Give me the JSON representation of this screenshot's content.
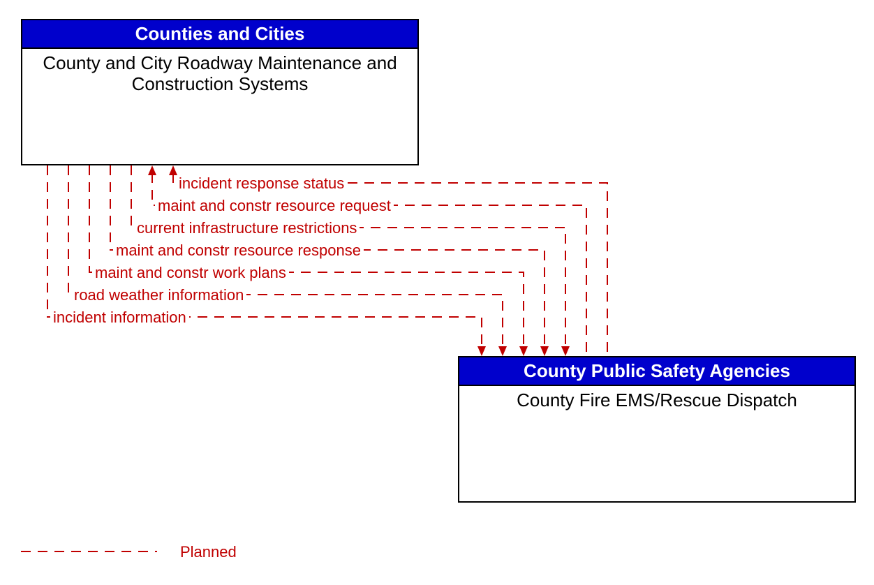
{
  "box_top": {
    "header": "Counties and Cities",
    "body": "County and City Roadway Maintenance and Construction Systems"
  },
  "box_bottom": {
    "header": "County Public Safety Agencies",
    "body": "County Fire EMS/Rescue Dispatch"
  },
  "flows": [
    "incident response status",
    "maint and constr resource request",
    "current infrastructure restrictions",
    "maint and constr resource response",
    "maint and constr work plans",
    "road weather information",
    "incident information"
  ],
  "legend": "Planned",
  "colors": {
    "header_bg": "#0000cc",
    "flow": "#c00000"
  }
}
